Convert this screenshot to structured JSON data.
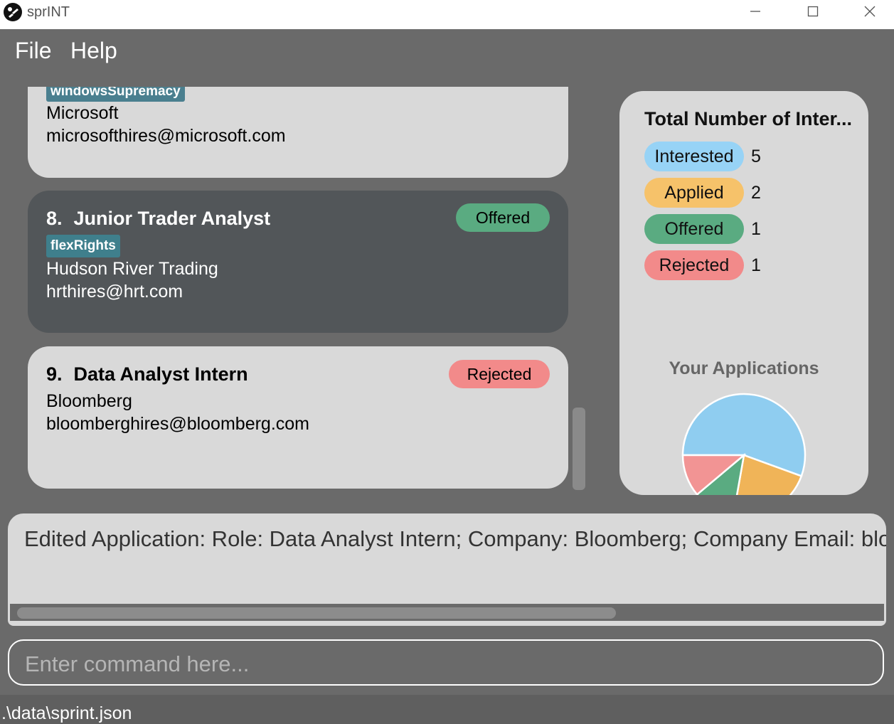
{
  "window": {
    "title": "sprINT"
  },
  "menu": {
    "file": "File",
    "help": "Help"
  },
  "applications": [
    {
      "tag": "windowsSupremacy",
      "company": "Microsoft",
      "email": "microsofthires@microsoft.com"
    },
    {
      "index": "8.",
      "role": "Junior Trader Analyst",
      "status": "Offered",
      "tag": "flexRights",
      "company": "Hudson River Trading",
      "email": "hrthires@hrt.com"
    },
    {
      "index": "9.",
      "role": "Data Analyst Intern",
      "status": "Rejected",
      "company": "Bloomberg",
      "email": "bloomberghires@bloomberg.com"
    }
  ],
  "stats": {
    "title": "Total Number of Inter...",
    "rows": [
      {
        "label": "Interested",
        "count": "5",
        "color": "#97d3f6"
      },
      {
        "label": "Applied",
        "count": "2",
        "color": "#f6c26a"
      },
      {
        "label": "Offered",
        "count": "1",
        "color": "#5aab81"
      },
      {
        "label": "Rejected",
        "count": "1",
        "color": "#f28a8a"
      }
    ]
  },
  "chart_data": {
    "type": "pie",
    "title": "Your Applications",
    "slices": [
      {
        "label": "Interested",
        "value": 5,
        "color": "#8fcdf0"
      },
      {
        "label": "Applied",
        "value": 2,
        "color": "#f0b458"
      },
      {
        "label": "Offered",
        "value": 1,
        "color": "#5aab81"
      },
      {
        "label": "Rejected",
        "value": 1,
        "color": "#f29494"
      }
    ]
  },
  "result": {
    "text": "Edited Application: Role: Data Analyst Intern; Company: Bloomberg; Company Email: bloomberghires@bloomberg.com"
  },
  "command": {
    "placeholder": "Enter command here..."
  },
  "statusbar": {
    "path": ".\\data\\sprint.json"
  }
}
